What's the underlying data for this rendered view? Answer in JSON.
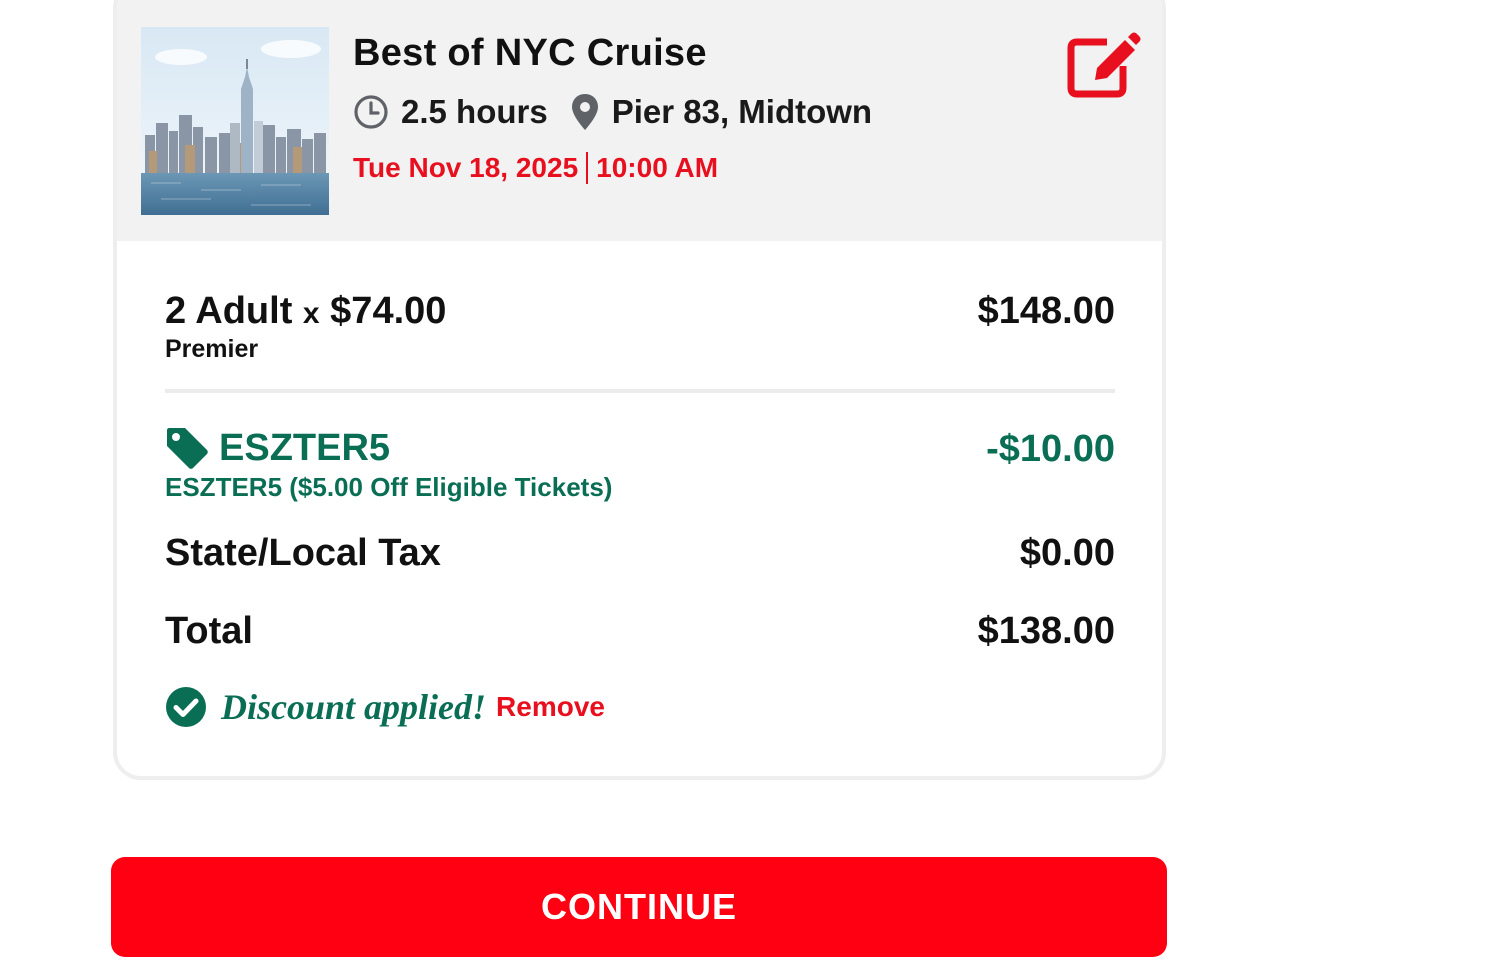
{
  "tour": {
    "title": "Best of NYC Cruise",
    "duration": "2.5 hours",
    "location": "Pier 83, Midtown",
    "date": "Tue Nov 18, 2025",
    "time": "10:00 AM",
    "duration_icon": "clock-icon",
    "location_icon": "map-pin-icon",
    "edit_icon": "edit-icon",
    "image": "nyc-skyline-photo"
  },
  "line_items": {
    "tickets": {
      "qty_label": "2 Adult",
      "times": "x",
      "unit_price": "$74.00",
      "tier": "Premier",
      "amount": "$148.00"
    },
    "promo": {
      "icon": "tag-icon",
      "code": "ESZTER5",
      "description": "ESZTER5 ($5.00 Off Eligible Tickets)",
      "amount": "-$10.00"
    },
    "tax": {
      "label": "State/Local Tax",
      "amount": "$0.00"
    },
    "total": {
      "label": "Total",
      "amount": "$138.00"
    }
  },
  "discount_status": {
    "icon": "check-circle-icon",
    "message": "Discount applied!",
    "remove_label": "Remove"
  },
  "actions": {
    "continue_label": "CONTINUE"
  },
  "colors": {
    "brand_red": "#ff0013",
    "accent_red_text": "#e8101f",
    "discount_green": "#0a6e55",
    "header_bg": "#f2f2f2"
  }
}
